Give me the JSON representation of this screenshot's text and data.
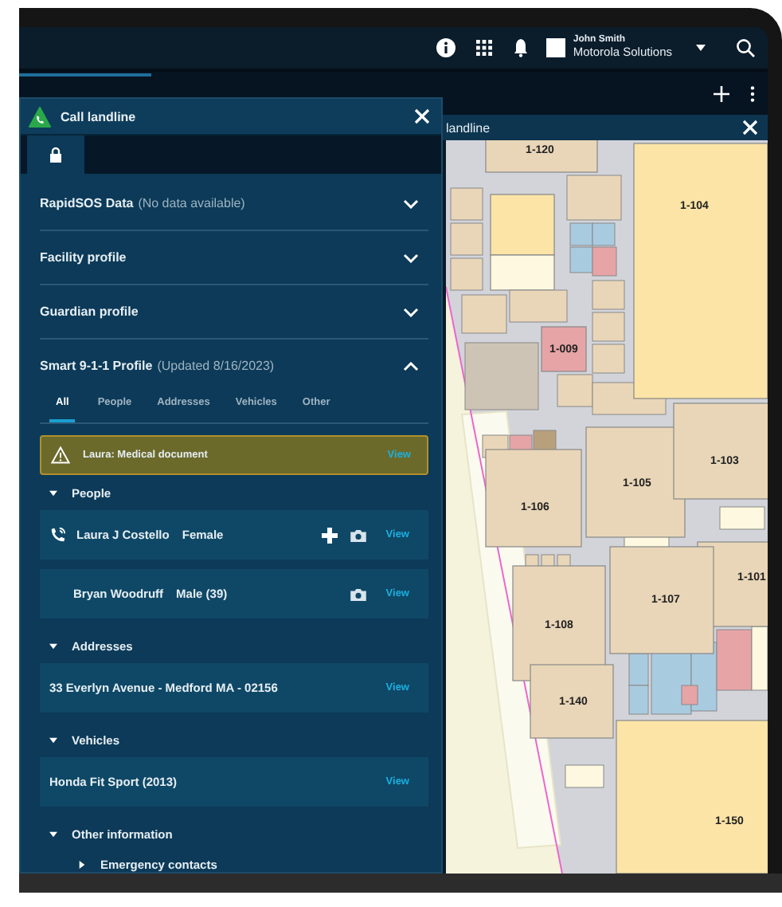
{
  "top_bar": {
    "user_name": "John Smith",
    "organization": "Motorola Solutions"
  },
  "map_window": {
    "title": "landline",
    "rooms": [
      {
        "label": "1-120"
      },
      {
        "label": "1-104"
      },
      {
        "label": "1-009"
      },
      {
        "label": "1-106"
      },
      {
        "label": "1-105"
      },
      {
        "label": "1-103"
      },
      {
        "label": "1-101"
      },
      {
        "label": "1-107"
      },
      {
        "label": "1-108"
      },
      {
        "label": "1-140"
      },
      {
        "label": "1-150"
      }
    ]
  },
  "call_panel": {
    "title": "Call landline",
    "sections": [
      {
        "title": "RapidSOS Data",
        "note": "(No data available)",
        "expanded": false
      },
      {
        "title": "Facility profile",
        "expanded": false
      },
      {
        "title": "Guardian profile",
        "expanded": false
      },
      {
        "title": "Smart 9-1-1 Profile",
        "note": "(Updated 8/16/2023)",
        "expanded": true
      }
    ],
    "profile_tabs": [
      {
        "label": "All",
        "selected": true
      },
      {
        "label": "People",
        "selected": false
      },
      {
        "label": "Addresses",
        "selected": false
      },
      {
        "label": "Vehicles",
        "selected": false
      },
      {
        "label": "Other",
        "selected": false
      }
    ],
    "alert": {
      "text": "Laura: Medical document",
      "action": "View"
    },
    "groups": [
      {
        "title": "People",
        "expanded": true,
        "items": [
          {
            "name": "Laura J Costello",
            "detail": "Female",
            "calling": true,
            "medical": true,
            "photo": true,
            "action": "View"
          },
          {
            "name": "Bryan Woodruff",
            "detail": "Male (39)",
            "calling": false,
            "medical": false,
            "photo": true,
            "action": "View"
          }
        ]
      },
      {
        "title": "Addresses",
        "expanded": true,
        "items": [
          {
            "name": "33 Everlyn Avenue - Medford MA - 02156",
            "calling": false,
            "medical": false,
            "photo": false,
            "action": "View"
          }
        ]
      },
      {
        "title": "Vehicles",
        "expanded": true,
        "items": [
          {
            "name": "Honda Fit Sport (2013)",
            "calling": false,
            "medical": false,
            "photo": false,
            "action": "View"
          }
        ]
      },
      {
        "title": "Other information",
        "expanded": true,
        "children": [
          {
            "title": "Emergency contacts",
            "expanded": false
          }
        ]
      }
    ]
  }
}
